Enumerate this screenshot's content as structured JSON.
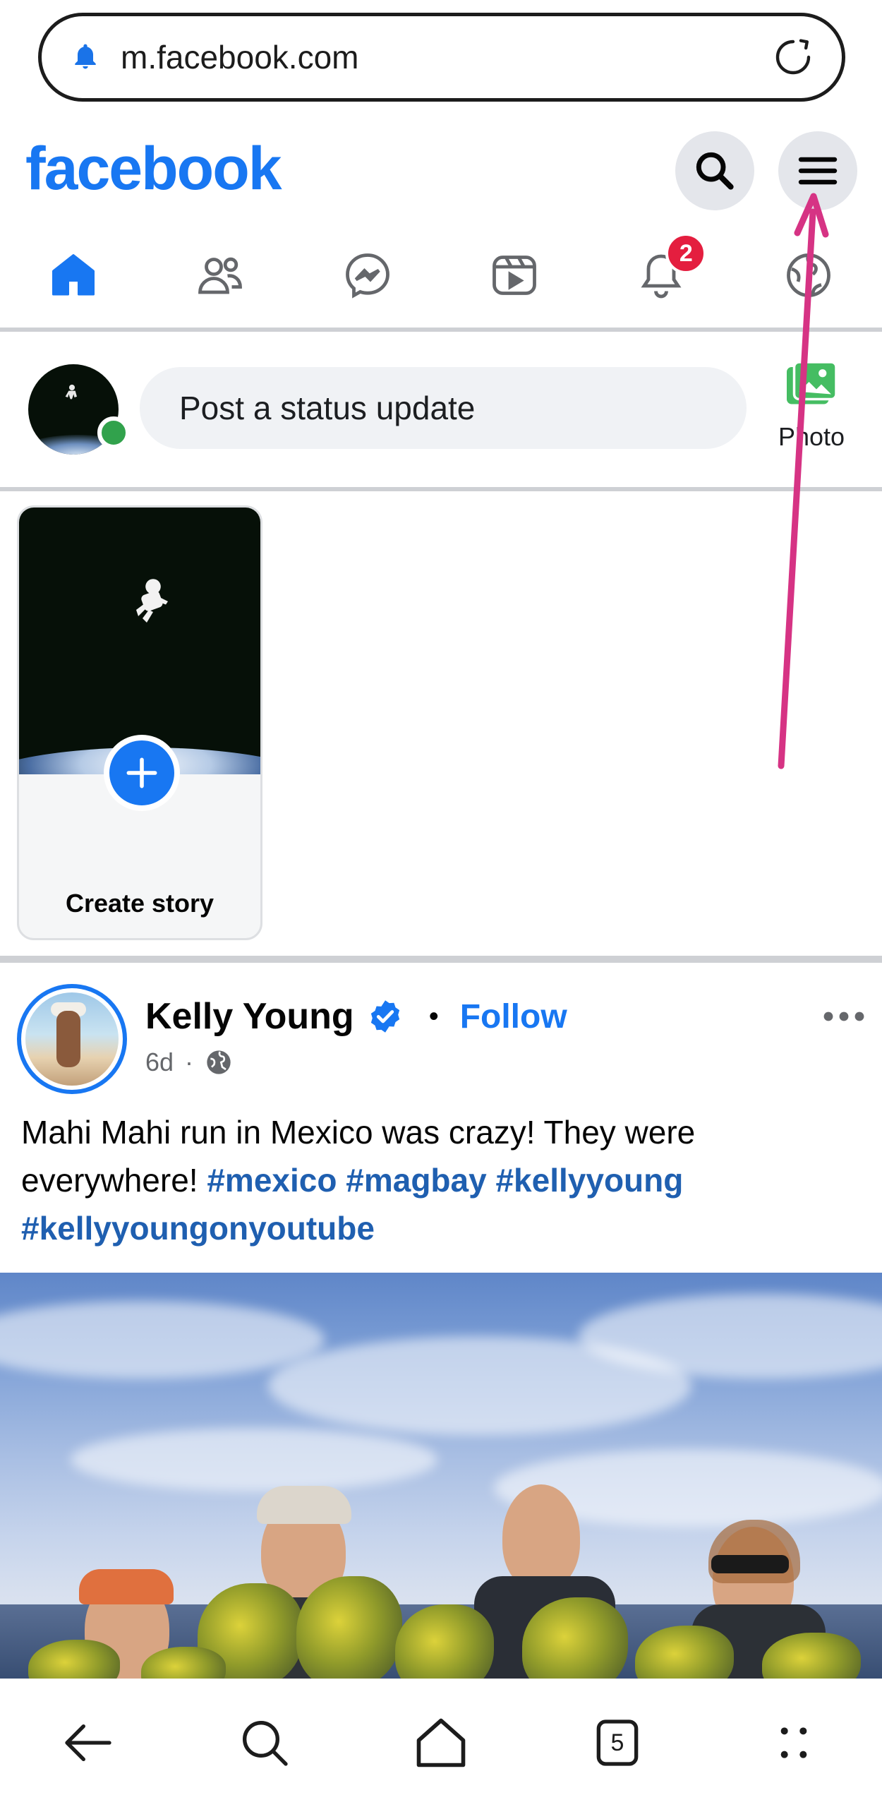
{
  "browser": {
    "url": "m.facebook.com",
    "tab_count": "5"
  },
  "header": {
    "logo": "facebook"
  },
  "nav": {
    "tabs": [
      "Home",
      "Friends",
      "Messenger",
      "Video",
      "Notifications",
      "Marketplace"
    ],
    "notification_badge": "2"
  },
  "composer": {
    "placeholder": "Post a status update",
    "photo_label": "Photo"
  },
  "stories": {
    "create_label": "Create story"
  },
  "post": {
    "author": "Kelly Young",
    "follow_label": "Follow",
    "dot": "•",
    "time": "6d",
    "meta_sep": "·",
    "text": "Mahi Mahi run in Mexico was crazy! They were everywhere! ",
    "hashtags": [
      "#mexico",
      "#magbay",
      "#kellyyoung",
      "#kellyyoungonyoutube"
    ]
  },
  "colors": {
    "brand": "#1877f2",
    "badge": "#e41e3f",
    "online": "#31a24c",
    "annotation_arrow": "#d63384"
  }
}
